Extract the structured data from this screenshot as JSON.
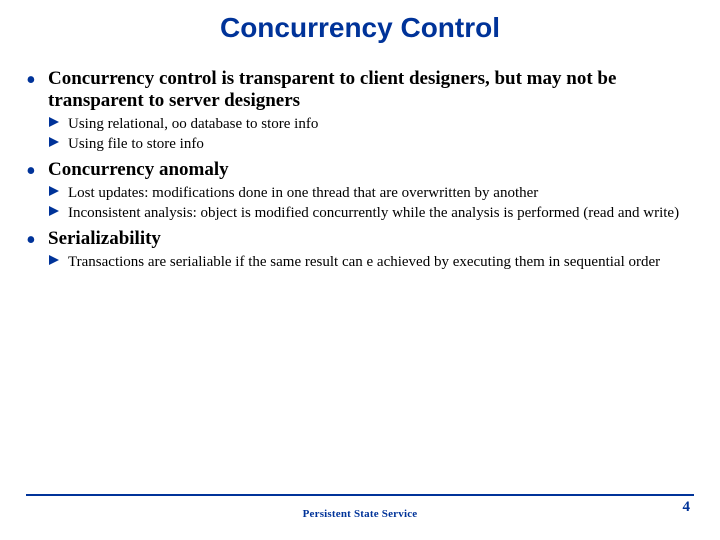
{
  "title": "Concurrency Control",
  "bullets": [
    {
      "text": "Concurrency control is transparent to client designers, but may not be transparent to server designers",
      "sub": [
        "Using relational, oo database to store info",
        "Using file to store info"
      ]
    },
    {
      "text": "Concurrency anomaly",
      "sub": [
        "Lost updates: modifications done in one thread that are overwritten by another",
        "Inconsistent analysis: object is modified concurrently while the analysis is performed (read and write)"
      ]
    },
    {
      "text": "Serializability",
      "sub": [
        "Transactions are serialiable if the same result can e achieved by executing them in sequential order"
      ]
    }
  ],
  "footer": "Persistent State Service",
  "page": "4"
}
